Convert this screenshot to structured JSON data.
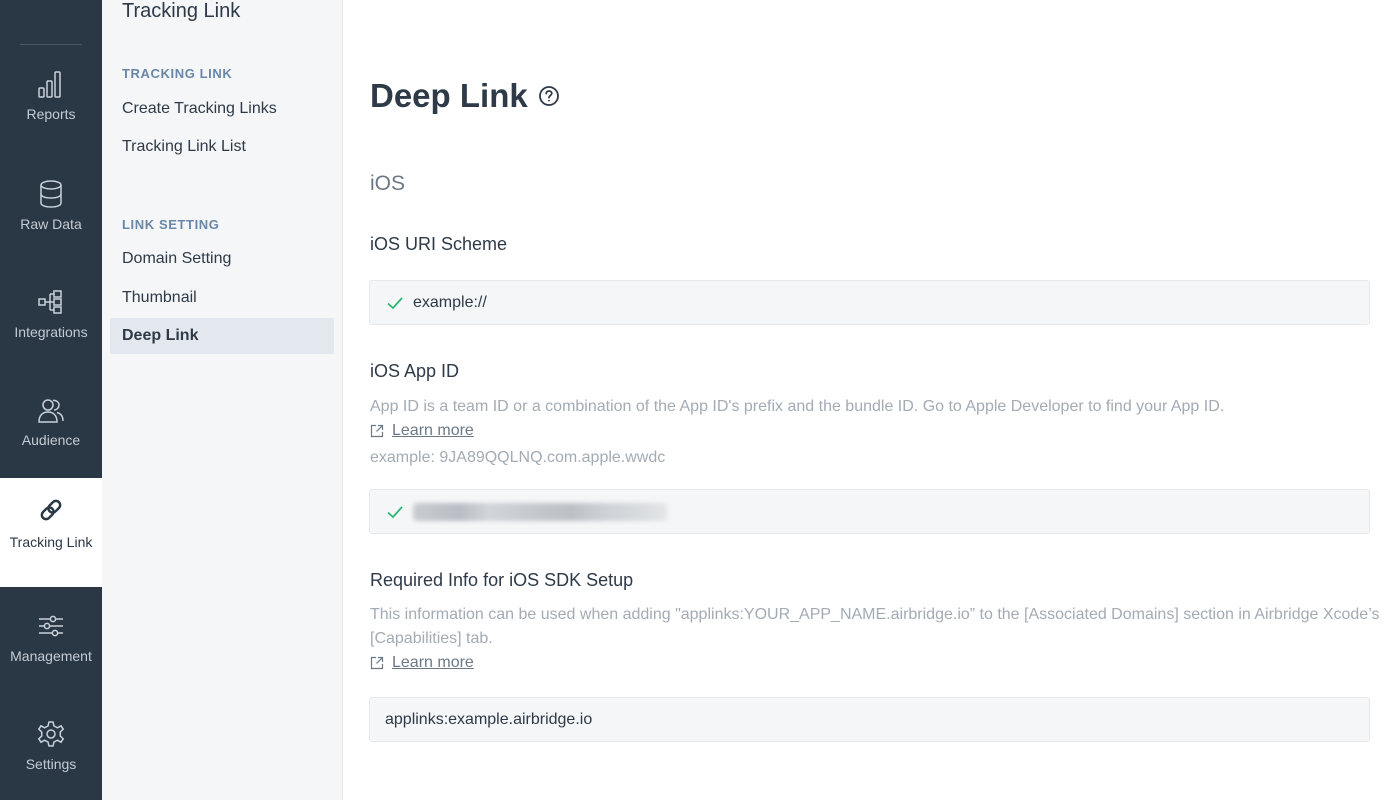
{
  "rail": {
    "items": [
      {
        "label": "Reports",
        "icon": "bar-chart-icon"
      },
      {
        "label": "Raw Data",
        "icon": "database-icon"
      },
      {
        "label": "Integrations",
        "icon": "integrations-icon"
      },
      {
        "label": "Audience",
        "icon": "audience-icon"
      },
      {
        "label": "Tracking Link",
        "icon": "link-icon",
        "active": true
      },
      {
        "label": "Management",
        "icon": "sliders-icon"
      },
      {
        "label": "Settings",
        "icon": "gear-icon"
      }
    ]
  },
  "subnav": {
    "title": "Tracking Link",
    "sections": [
      {
        "heading": "TRACKING LINK",
        "links": [
          "Create Tracking Links",
          "Tracking Link List"
        ]
      },
      {
        "heading": "LINK SETTING",
        "links": [
          "Domain Setting",
          "Thumbnail",
          "Deep Link"
        ]
      }
    ],
    "active_link": "Deep Link"
  },
  "main": {
    "title": "Deep Link",
    "section": "iOS",
    "uri_scheme": {
      "label": "iOS URI Scheme",
      "value": "example://"
    },
    "app_id": {
      "label": "iOS App ID",
      "help": "App ID is a team ID or a combination of the App ID's prefix and the bundle ID. Go to Apple Developer to find your App ID.",
      "learn_more": "Learn more",
      "example": "example: 9JA89QQLNQ.com.apple.wwdc"
    },
    "sdk_setup": {
      "label": "Required Info for iOS SDK Setup",
      "help": "This information can be used when adding \"applinks:YOUR_APP_NAME.airbridge.io” to the [Associated Domains] section in Airbridge Xcode’s [Capabilities] tab.",
      "learn_more": "Learn more",
      "value": "applinks:example.airbridge.io"
    }
  },
  "colors": {
    "rail_bg": "#2a3744",
    "subnav_bg": "#f4f6f8",
    "success_check": "#2bb673",
    "section_heading": "#6a87a7"
  }
}
